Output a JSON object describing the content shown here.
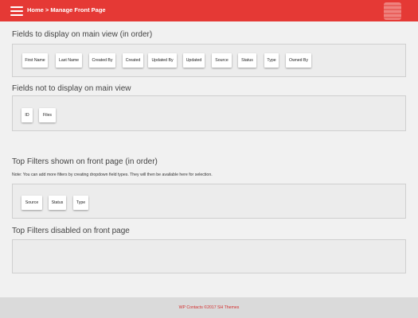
{
  "header": {
    "breadcrumb_home": "Home",
    "breadcrumb_sep": " > ",
    "breadcrumb_current": "Manage Front Page"
  },
  "sections": {
    "main_fields_title": "Fields to display on main view (in order)",
    "hidden_fields_title": "Fields not to display on main view",
    "top_filters_title": "Top Filters shown on front page (in order)",
    "top_filters_note": "Note: You can add more filters by creating dropdown field types. They will then be available here for selection.",
    "disabled_filters_title": "Top Filters disabled on front page"
  },
  "main_fields": [
    "First Name",
    "Last Name",
    "Created By",
    "Created",
    "Updated By",
    "Updated",
    "Source",
    "Status",
    "Type",
    "Owned By"
  ],
  "hidden_fields": [
    "ID",
    "Files"
  ],
  "top_filters": [
    "Source",
    "Status",
    "Type"
  ],
  "disabled_filters": [],
  "footer": {
    "text": "WP Contacts ©2017 SH Themes"
  },
  "colors": {
    "header": "#e53935",
    "footer_text": "#d32f2f",
    "drop_zone": "#ececec"
  }
}
